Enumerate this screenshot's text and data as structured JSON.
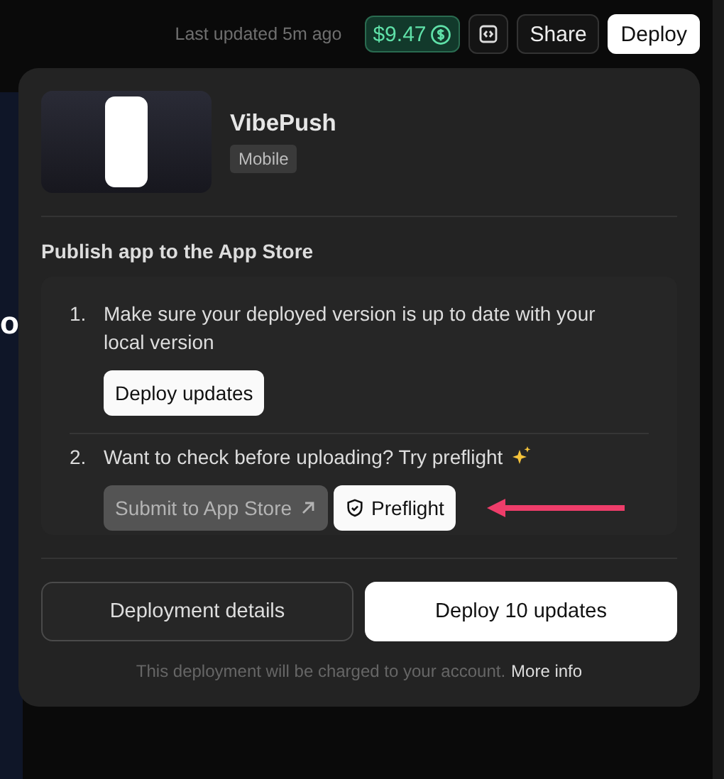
{
  "background": {
    "fragment": "o"
  },
  "topbar": {
    "status": "Last updated 5m ago",
    "balance": "$9.47",
    "buttons": [
      {
        "label": "Share",
        "kind": "outline"
      },
      {
        "label": "Deploy",
        "kind": "solid"
      }
    ]
  },
  "app": {
    "name": "VibePush",
    "tag": "Mobile"
  },
  "section_title": "Publish app to the App Store",
  "steps": [
    {
      "number": "1.",
      "text": "Make sure your deployed version is up to date with your local version",
      "buttons": [
        {
          "label": "Deploy updates",
          "kind": "plain"
        }
      ]
    },
    {
      "number": "2.",
      "text": "Want to check before uploading? Try preflight",
      "buttons": [
        {
          "label": "Submit to App Store",
          "kind": "external"
        },
        {
          "label": "Preflight",
          "kind": "shield"
        }
      ]
    }
  ],
  "footer": {
    "buttons": [
      {
        "label": "Deployment details",
        "kind": "outline"
      },
      {
        "label": "Deploy 10 updates",
        "kind": "solid"
      }
    ],
    "note": "This deployment will be charged to your account.",
    "link": "More info"
  }
}
